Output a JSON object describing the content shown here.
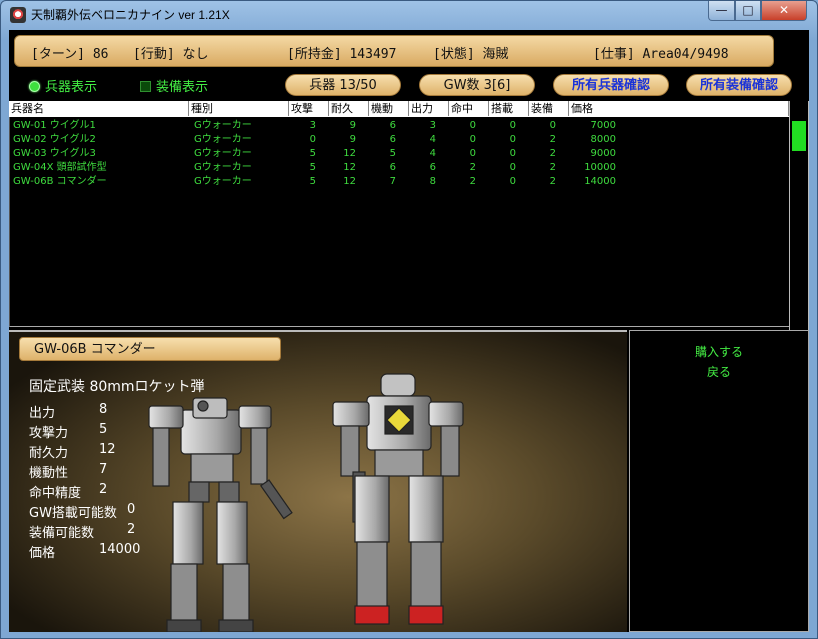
{
  "window": {
    "title": "天制覇外伝ベロニカナイン ver 1.21X"
  },
  "status": {
    "turn": "[ターン] 86",
    "action": "[行動] なし",
    "money": "[所持金] 143497",
    "state": "[状態] 海賊",
    "job": "[仕事] Area04/9498"
  },
  "toggles": {
    "weapons": "兵器表示",
    "equipment": "装備表示"
  },
  "counters": {
    "weapons": "兵器 13/50",
    "gw": "GW数 3[6]"
  },
  "actions": {
    "check_weapons": "所有兵器確認",
    "check_equipment": "所有装備確認"
  },
  "table": {
    "columns": [
      "兵器名",
      "種別",
      "攻撃",
      "耐久",
      "機動",
      "出力",
      "命中",
      "搭載",
      "装備",
      "価格"
    ],
    "rows": [
      [
        "GW-01 ウイグル1",
        "Gウォーカー",
        "3",
        "9",
        "6",
        "3",
        "0",
        "0",
        "0",
        "7000"
      ],
      [
        "GW-02 ウイグル2",
        "Gウォーカー",
        "0",
        "9",
        "6",
        "4",
        "0",
        "0",
        "2",
        "8000"
      ],
      [
        "GW-03 ウイグル3",
        "Gウォーカー",
        "5",
        "12",
        "5",
        "4",
        "0",
        "0",
        "2",
        "9000"
      ],
      [
        "GW-04X 頭部試作型",
        "Gウォーカー",
        "5",
        "12",
        "6",
        "6",
        "2",
        "0",
        "2",
        "10000"
      ],
      [
        "GW-06B コマンダー",
        "Gウォーカー",
        "5",
        "12",
        "7",
        "8",
        "2",
        "0",
        "2",
        "14000"
      ]
    ]
  },
  "detail": {
    "name": "GW-06B コマンダー",
    "weapon": "固定武装 80mmロケット弾",
    "stats": [
      {
        "label": "出力",
        "value": "8"
      },
      {
        "label": "攻撃力",
        "value": "5"
      },
      {
        "label": "耐久力",
        "value": "12"
      },
      {
        "label": "機動性",
        "value": "7"
      },
      {
        "label": "命中精度",
        "value": "2"
      },
      {
        "label": "GW搭載可能数",
        "value": "0"
      },
      {
        "label": "装備可能数",
        "value": "2"
      },
      {
        "label": "価格",
        "value": "14000"
      }
    ]
  },
  "menu": {
    "buy": "購入する",
    "back": "戻る"
  },
  "colors": {
    "accent_green": "#3fdc3f",
    "pill": "#deb26a",
    "action_text": "#1b33d8"
  }
}
